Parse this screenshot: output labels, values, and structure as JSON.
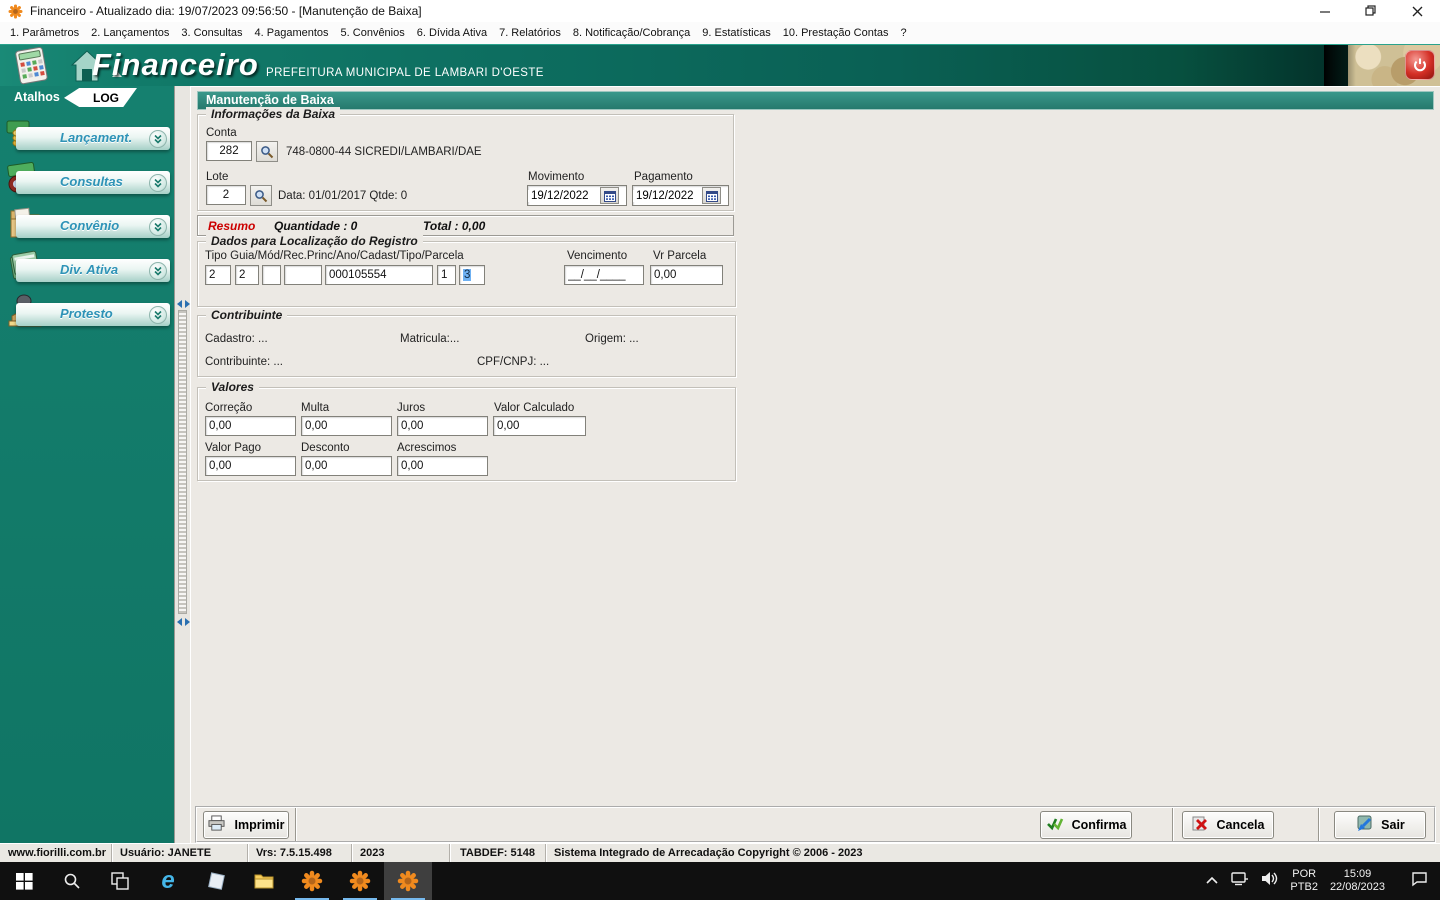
{
  "window": {
    "title": "Financeiro - Atualizado dia: 19/07/2023 09:56:50 - [Manutenção de Baixa]"
  },
  "menubar": {
    "items": [
      "1. Parâmetros",
      "2. Lançamentos",
      "3. Consultas",
      "4. Pagamentos",
      "5. Convênios",
      "6. Dívida Ativa",
      "7. Relatórios",
      "8. Notificação/Cobrança",
      "9. Estatísticas",
      "10. Prestação Contas",
      "?"
    ]
  },
  "header": {
    "app_name": "Financeiro",
    "subtitle": "PREFEITURA MUNICIPAL DE LAMBARI D'OESTE"
  },
  "sidebar": {
    "atalhos_label": "Atalhos",
    "log_label": "LOG",
    "items": [
      {
        "label": "Lançament.",
        "icon": "coins-stack-icon"
      },
      {
        "label": "Consultas",
        "icon": "binoculars-icon"
      },
      {
        "label": "Convênio",
        "icon": "folder-doc-icon"
      },
      {
        "label": "Div. Ativa",
        "icon": "ledger-book-icon"
      },
      {
        "label": "Protesto",
        "icon": "stamp-icon"
      }
    ]
  },
  "form": {
    "title": "Manutenção de Baixa",
    "info": {
      "title": "Informações da Baixa",
      "conta_label": "Conta",
      "conta_value": "282",
      "conta_desc": "748-0800-44 SICREDI/LAMBARI/DAE",
      "lote_label": "Lote",
      "lote_value": "2",
      "lote_desc": "Data: 01/01/2017 Qtde: 0",
      "movimento_label": "Movimento",
      "movimento_value": "19/12/2022",
      "pagamento_label": "Pagamento",
      "pagamento_value": "19/12/2022"
    },
    "resumo": {
      "label": "Resumo",
      "quantidade": "Quantidade : 0",
      "total": "Total : 0,00"
    },
    "localizacao": {
      "title": "Dados para Localização do Registro",
      "fields_label": "Tipo Guia/Mód/Rec.Princ/Ano/Cadast/Tipo/Parcela",
      "tipo": "2",
      "guia": "2",
      "mod": "",
      "rec": "",
      "princ": "000105554",
      "tipo2": "1",
      "parcela": "3",
      "vencimento_label": "Vencimento",
      "vencimento_value": "__/__/____",
      "vr_parcela_label": "Vr Parcela",
      "vr_parcela_value": "0,00"
    },
    "contribuinte": {
      "title": "Contribuinte",
      "cadastro": "Cadastro: ...",
      "matricula": "Matricula:...",
      "origem": "Origem: ...",
      "contribuinte": "Contribuinte: ...",
      "cpf_cnpj": "CPF/CNPJ: ..."
    },
    "valores": {
      "title": "Valores",
      "correcao_label": "Correção",
      "correcao": "0,00",
      "multa_label": "Multa",
      "multa": "0,00",
      "juros_label": "Juros",
      "juros": "0,00",
      "valor_calculado_label": "Valor Calculado",
      "valor_calculado": "0,00",
      "valor_pago_label": "Valor Pago",
      "valor_pago": "0,00",
      "desconto_label": "Desconto",
      "desconto": "0,00",
      "acrescimos_label": "Acrescimos",
      "acrescimos": "0,00"
    },
    "buttons": {
      "imprimir": "Imprimir",
      "confirma": "Confirma",
      "cancela": "Cancela",
      "sair": "Sair"
    }
  },
  "statusbar": {
    "segments": [
      "www.fiorilli.com.br",
      "Usuário: JANETE",
      "Vrs: 7.5.15.498",
      "2023",
      "TABDEF: 5148",
      "Sistema Integrado de Arrecadação Copyright © 2006 - 2023"
    ]
  },
  "taskbar": {
    "tray": {
      "lang_line1": "POR",
      "lang_line2": "PTB2",
      "time": "15:09",
      "date": "22/08/2023"
    },
    "icons": [
      "windows-start-icon",
      "search-icon",
      "task-view-icon",
      "ie-icon",
      "app-icon",
      "file-explorer-icon",
      "fiorilli-app-icon",
      "fiorilli-app-icon",
      "fiorilli-app-icon"
    ],
    "tray_icons": [
      "chevron-up-icon",
      "network-icon",
      "volume-icon",
      "action-center-icon"
    ]
  },
  "colors": {
    "header_teal": "#0d6e60",
    "panel_title_teal": "#2e8a7d",
    "sidebar_teal": "#137c6c",
    "resumo_red": "#cc0000",
    "selection_blue": "#6fb1f2"
  }
}
